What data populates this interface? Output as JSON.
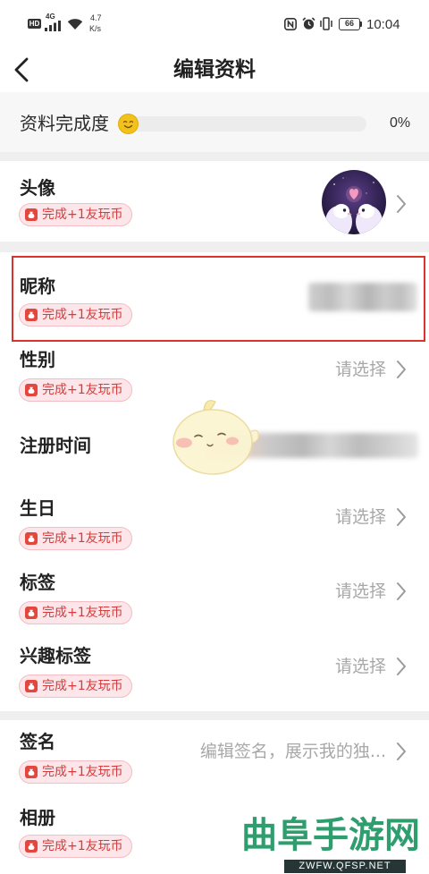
{
  "status_bar": {
    "hd": "HD",
    "network": "4G",
    "speed": "4.7",
    "speed_unit": "K/s",
    "battery": "66",
    "time": "10:04",
    "icons": [
      "signal-icon",
      "wifi-icon",
      "nfc-icon",
      "alarm-icon",
      "vibrate-icon",
      "battery-icon"
    ]
  },
  "header": {
    "title": "编辑资料",
    "back_icon": "chevron-left-icon"
  },
  "completion": {
    "label": "资料完成度",
    "percent": "0%",
    "progress_fraction": 0,
    "icon": "smiley-face-icon"
  },
  "rows": [
    {
      "label": "头像",
      "badge": "完成+1友玩币"
    },
    {
      "label": "昵称",
      "badge": "完成+1友玩币"
    },
    {
      "label": "性别",
      "badge": "完成+1友玩币",
      "value": "请选择"
    },
    {
      "label": "注册时间"
    },
    {
      "label": "生日",
      "badge": "完成+1友玩币",
      "value": "请选择"
    },
    {
      "label": "标签",
      "badge": "完成+1友玩币",
      "value": "请选择"
    },
    {
      "label": "兴趣标签",
      "badge": "完成+1友玩币",
      "value": "请选择"
    },
    {
      "label": "签名",
      "badge": "完成+1友玩币",
      "value": "编辑签名，展示我的独..."
    },
    {
      "label": "相册",
      "badge": "完成+1友玩币"
    }
  ],
  "watermark": {
    "site_name": "曲阜手游网",
    "site_url": "ZWFW.QFSP.NET"
  },
  "colors": {
    "highlight_border": "#d9342b",
    "badge_text": "#d23c3c",
    "badge_background": "#fde6e9",
    "placeholder_text": "#a8a8a8",
    "progress_track": "#ececec",
    "smiley": "#f2c21b"
  }
}
